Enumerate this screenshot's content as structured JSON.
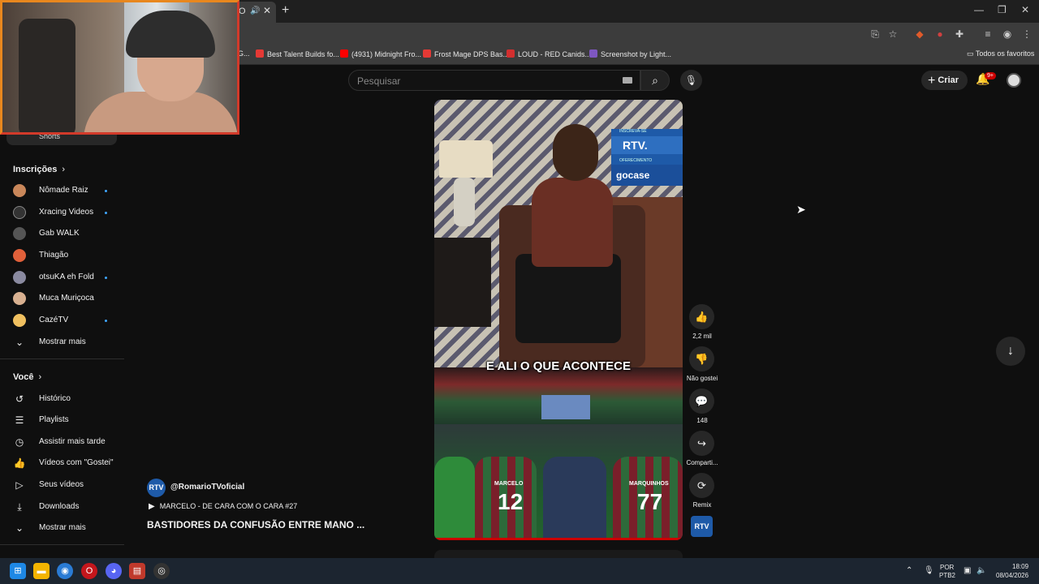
{
  "browser": {
    "tab_title_fragment": "O",
    "tab_close": "✕",
    "new_tab": "+",
    "bookmarks": [
      {
        "label": "G...",
        "color": "#4caf50"
      },
      {
        "label": "Best Talent Builds fo...",
        "color": "#e53935"
      },
      {
        "label": "(4931) Midnight Fro...",
        "color": "#ff0000"
      },
      {
        "label": "Frost Mage DPS Bas...",
        "color": "#e53935"
      },
      {
        "label": "LOUD - RED Canids...",
        "color": "#d32f2f"
      },
      {
        "label": "Screenshot by Light...",
        "color": "#7e57c2"
      }
    ],
    "all_bookmarks": "Todos os favoritos"
  },
  "header": {
    "search_placeholder": "Pesquisar",
    "search_icon": "search-icon",
    "mic_icon": "mic-icon",
    "create_label": "Criar",
    "notifications_badge": "9+"
  },
  "sidebar": {
    "shorts_label": "Shorts",
    "subscriptions_heading": "Inscrições",
    "subscriptions": [
      {
        "label": "Nômade Raiz",
        "new": true,
        "color": "#c9875a"
      },
      {
        "label": "Xracing Videos",
        "new": true,
        "color": "#333333"
      },
      {
        "label": "Gab WALK",
        "new": false,
        "color": "#555555"
      },
      {
        "label": "Thiagão",
        "new": false,
        "color": "#e0603a"
      },
      {
        "label": "otsuKA eh Fold",
        "new": true,
        "color": "#8a8aa0"
      },
      {
        "label": "Muca Muriçoca",
        "new": false,
        "color": "#d8b090"
      },
      {
        "label": "CazéTV",
        "new": true,
        "color": "#f0c060"
      }
    ],
    "show_more_1": "Mostrar mais",
    "you_heading": "Você",
    "you_items": [
      {
        "label": "Histórico",
        "icon": "history-icon"
      },
      {
        "label": "Playlists",
        "icon": "playlists-icon"
      },
      {
        "label": "Assistir mais tarde",
        "icon": "watch-later-icon"
      },
      {
        "label": "Vídeos com \"Gostei\"",
        "icon": "liked-icon"
      },
      {
        "label": "Seus vídeos",
        "icon": "your-videos-icon"
      },
      {
        "label": "Downloads",
        "icon": "downloads-icon"
      }
    ],
    "show_more_2": "Mostrar mais"
  },
  "video": {
    "caption": "E ALI O QUE ACONTECE",
    "overlay_subscribe": "INSCREVA-SE",
    "overlay_brand": "RTV.",
    "overlay_sponsor_caption": "OFERECIMENTO",
    "overlay_sponsor": "gocase",
    "player_names": [
      "MARCELO",
      "MARQUINHOS"
    ],
    "player_numbers": [
      "12",
      "77"
    ]
  },
  "channel": {
    "avatar_text": "RTV",
    "name": "@RomarioTVoficial",
    "playlist": "MARCELO - DE CARA COM O CARA #27",
    "title": "BASTIDORES DA CONFUSÃO ENTRE MANO ..."
  },
  "actions": {
    "likes": "2,2 mil",
    "dislike": "Não gostei",
    "comments": "148",
    "share": "Comparti...",
    "remix": "Remix"
  },
  "taskbar": {
    "lang_top": "POR",
    "lang_bottom": "PTB2",
    "time": "18:09",
    "date": "08/04/2026"
  }
}
